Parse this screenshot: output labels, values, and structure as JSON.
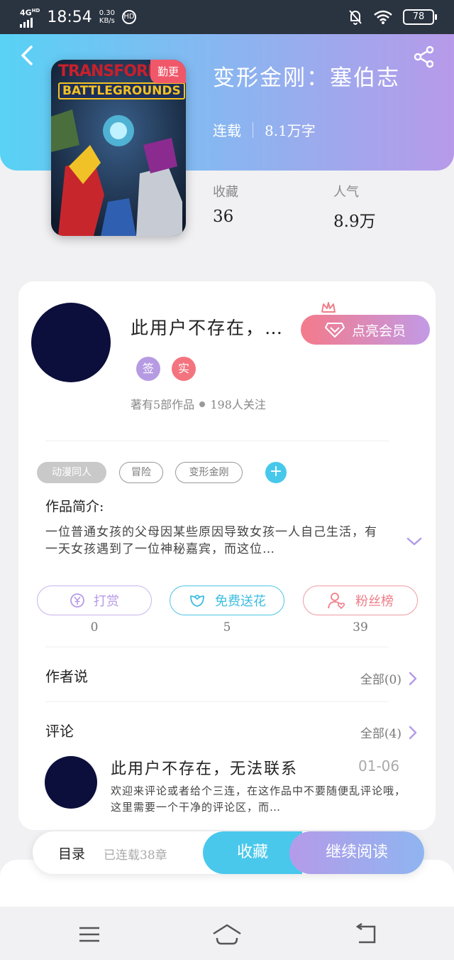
{
  "status_bar": {
    "network": "4G",
    "network_hd": "HD",
    "time": "18:54",
    "speed_value": "0.30",
    "speed_unit": "KB/s",
    "hd_icon": "HD",
    "battery": "78"
  },
  "header": {
    "title": "变形金刚：塞伯志",
    "status": "连载",
    "word_count": "8.1万字",
    "cover": {
      "tag": "勤更",
      "title_line1": "TRANSFORM",
      "title_line2": "BATTLEGROUNDS"
    },
    "stats": [
      {
        "label": "收藏",
        "value": "36"
      },
      {
        "label": "人气",
        "value": "8.9万"
      }
    ]
  },
  "author": {
    "name": "此用户不存在，…",
    "vip_label": "点亮会员",
    "badges": [
      {
        "label": "签",
        "color": "#b69be3"
      },
      {
        "label": "实",
        "color": "#f3747f"
      }
    ],
    "works_text": "著有5部作品",
    "followers_text": "198人关注"
  },
  "tags": [
    "动漫同人",
    "冒险",
    "变形金刚"
  ],
  "tag_add": "+",
  "intro": {
    "heading": "作品简介:",
    "text": "一位普通女孩的父母因某些原因导致女孩一人自己生活，有一天女孩遇到了一位神秘嘉宾，而这位…"
  },
  "actions": [
    {
      "label": "打赏",
      "count": "0",
      "color": "#b79be6",
      "icon": "yen-coin-icon"
    },
    {
      "label": "免费送花",
      "count": "5",
      "color": "#4cc5e6",
      "icon": "flower-icon"
    },
    {
      "label": "粉丝榜",
      "count": "39",
      "color": "#ef7d88",
      "icon": "fan-user-icon"
    }
  ],
  "author_says": {
    "title": "作者说",
    "more": "全部(0)"
  },
  "comments": {
    "title": "评论",
    "more": "全部(4)",
    "items": [
      {
        "name": "此用户不存在，无法联系",
        "date": "01-06",
        "text": "欢迎来评论或者给个三连，在这作品中不要随便乱评论哦，这里需要一个干净的评论区，而…"
      }
    ]
  },
  "bottom_bar": {
    "toc_label": "目录",
    "chapters": "已连载38章",
    "favorite_label": "收藏",
    "read_label": "继续阅读"
  },
  "colors": {
    "accent_blue": "#49c8ec",
    "accent_purple": "#b49be9",
    "accent_pink": "#f0586a"
  }
}
